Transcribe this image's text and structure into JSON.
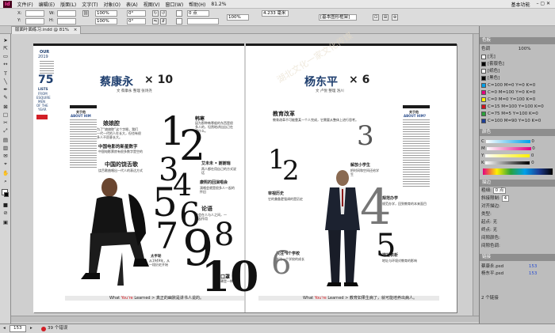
{
  "menu": {
    "logo": "Id",
    "items": [
      "文件(F)",
      "编辑(E)",
      "版面(L)",
      "文字(T)",
      "对象(O)",
      "表(A)",
      "视图(V)",
      "窗口(W)",
      "帮助(H)"
    ],
    "zoom": "81.2%",
    "workspace": "基本功能"
  },
  "control": {
    "x_label": "X:",
    "x_val": "",
    "y_label": "Y:",
    "y_val": "",
    "w_label": "W:",
    "h_label": "H:",
    "zoom_pct": "100%",
    "rotate": "0°",
    "stroke": "0 点",
    "offset": "4.233 毫米",
    "frame_label": "[基本图形框架]"
  },
  "tab": {
    "title": "版面叶面练习.indd @ 81%",
    "close": "×"
  },
  "doc": {
    "left": {
      "our": "OUR",
      "year": "2019",
      "big75": "75",
      "lists": "LISTS",
      "from": "FROM",
      "esquire": "ESQUIRE",
      "men": "MEN",
      "ofthe": "OF THE",
      "yearlbl": "YEAR",
      "guan": "关于他",
      "about": "ABOUT HIM",
      "name": "蔡康永",
      "times": "× 10",
      "byline": "文 蔡康永  整理 张诗尧",
      "h_niang": "娘娘腔",
      "h_china": "中国电影的新星数字",
      "h_chinese": "中国的饶舌歌",
      "h_hanhan": "韩寒",
      "h_aisheng": "艾未未 • 謝謝瑞",
      "h_kang": "康熙的回演唱会",
      "h_lun": "论语",
      "h_tai": "太平轮",
      "h_kou": "口罩",
      "footer_prefix": "What",
      "footer_you": "You're",
      "footer_learned": "Learned > 真正的幽默是讲书人说的。"
    },
    "right": {
      "name": "杨东平",
      "times": "× 6",
      "byline": "文 卢悦  整理 洛川",
      "guan": "关于他",
      "about": "ABOUT HIM?",
      "h_edu": "教育改革",
      "h_shen": "审视历史",
      "h_jie": "解放小学生",
      "h_guan": "关注一个学校",
      "h_zhu": "规范办学",
      "h_di": "地址表析",
      "footer_prefix": "What",
      "footer_you": "You're",
      "footer_learned": "Learned > 教育如果生病了，就可能培养出病人。",
      "watermark": "湖北文化一家文化传媒"
    }
  },
  "panels": {
    "swatches_title": "色板",
    "swatch_tint": "色调",
    "swatch_pct": "100%",
    "swatches": [
      {
        "name": "[无]",
        "color": "#ffffff"
      },
      {
        "name": "[套版色]",
        "color": "#000000"
      },
      {
        "name": "[纸色]",
        "color": "#ffffff"
      },
      {
        "name": "[黑色]",
        "color": "#000000"
      },
      {
        "name": "C=100 M=0 Y=0 K=0",
        "color": "#00a0e9"
      },
      {
        "name": "C=0 M=100 Y=0 K=0",
        "color": "#e4007f"
      },
      {
        "name": "C=0 M=0 Y=100 K=0",
        "color": "#fff100"
      },
      {
        "name": "C=15 M=100 Y=100 K=0",
        "color": "#d2141d"
      },
      {
        "name": "C=75 M=5 Y=100 K=0",
        "color": "#2aa23b"
      },
      {
        "name": "C=100 M=90 Y=10 K=0",
        "color": "#1e3e96"
      }
    ],
    "color_title": "颜色",
    "c": "C",
    "m": "M",
    "y": "Y",
    "k": "K",
    "cval": "0",
    "mval": "0",
    "yval": "0",
    "kval": "0",
    "stroke_title": "描边",
    "weight_label": "粗细:",
    "weight_val": "0 点",
    "miter_label": "斜接限制:",
    "miter_val": "4",
    "align_label": "对齐描边:",
    "type_label": "类型:",
    "start_label": "起点:",
    "end_label": "终点:",
    "none": "无",
    "gap_label": "间隙颜色:",
    "gap_tint": "间隙色调:",
    "links_title": "链接",
    "link1": "蔡康永.psd",
    "link1n": "153",
    "link2": "杨东平.psd",
    "link2n": "153",
    "links_count": "2 个链接"
  },
  "status": {
    "page": "153",
    "errors": "39 个错误"
  }
}
